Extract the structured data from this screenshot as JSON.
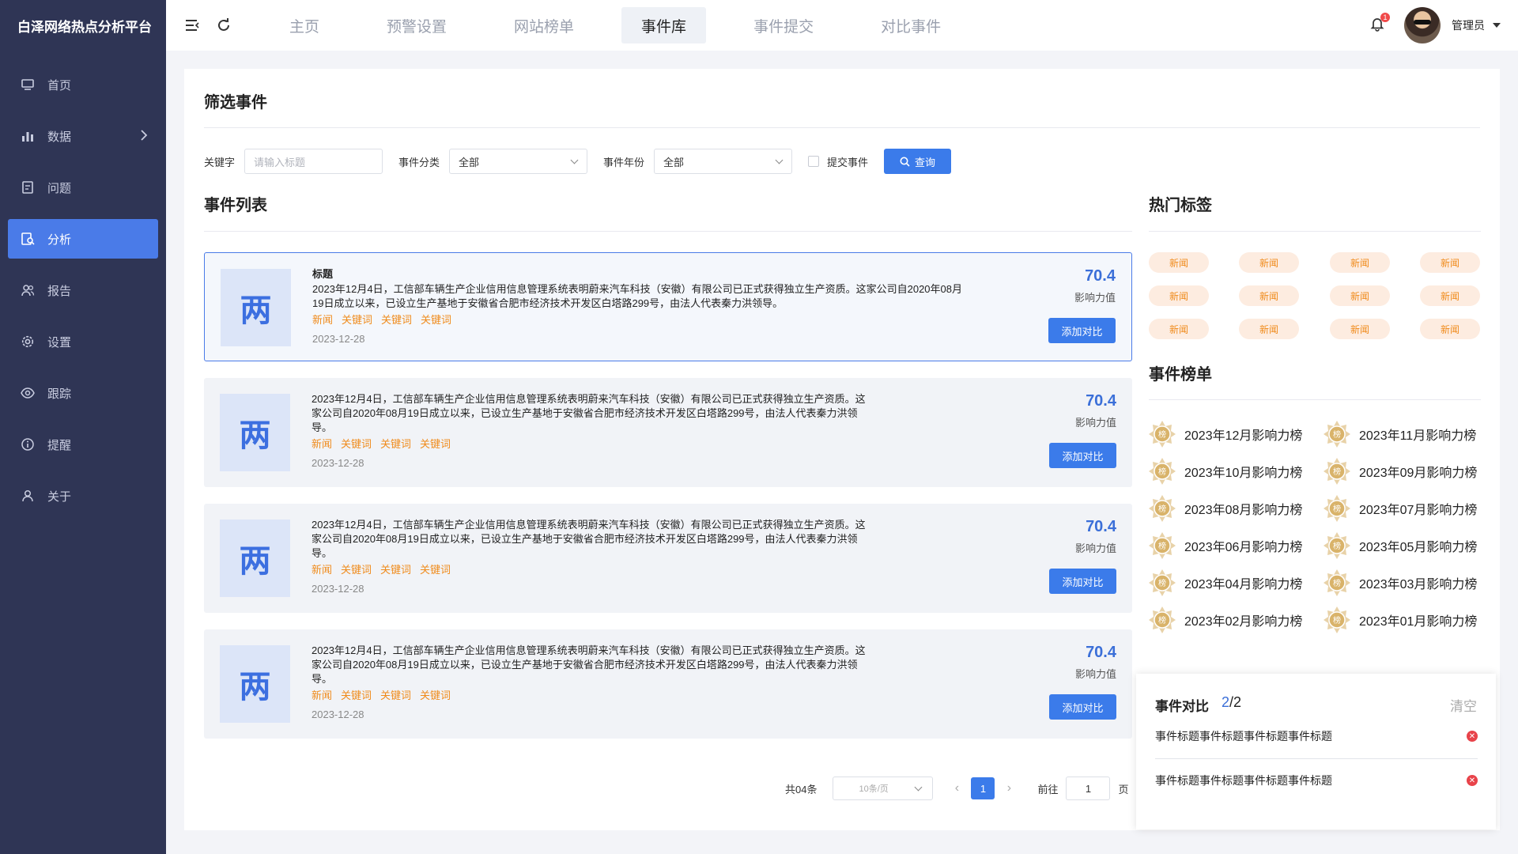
{
  "app": {
    "title": "白泽网络热点分析平台"
  },
  "sidebar": {
    "items": [
      {
        "label": "首页",
        "icon": "monitor-icon"
      },
      {
        "label": "数据",
        "icon": "bar-chart-icon"
      },
      {
        "label": "问题",
        "icon": "document-icon"
      },
      {
        "label": "分析",
        "icon": "analysis-icon",
        "active": true
      },
      {
        "label": "报告",
        "icon": "users-icon"
      },
      {
        "label": "设置",
        "icon": "gear-icon"
      },
      {
        "label": "跟踪",
        "icon": "eye-icon"
      },
      {
        "label": "提醒",
        "icon": "info-icon"
      },
      {
        "label": "关于",
        "icon": "user-icon"
      }
    ]
  },
  "header": {
    "tabs": [
      {
        "label": "主页"
      },
      {
        "label": "预警设置"
      },
      {
        "label": "网站榜单"
      },
      {
        "label": "事件库",
        "active": true
      },
      {
        "label": "事件提交"
      },
      {
        "label": "对比事件"
      }
    ],
    "notification_count": "1",
    "username": "管理员"
  },
  "filter": {
    "title": "筛选事件",
    "keyword_label": "关键字",
    "keyword_placeholder": "请输入标题",
    "category_label": "事件分类",
    "category_value": "全部",
    "year_label": "事件年份",
    "year_value": "全部",
    "submitted_label": "提交事件",
    "query_button": "查询"
  },
  "event_list": {
    "title": "事件列表",
    "items": [
      {
        "thumb": "两",
        "title": "标题",
        "lines": [
          "2023年12月4日，工信部车辆生产企业信用信息管理系统表明蔚来汽车科技（安徽）有限公司已正式获得独立生产资质。这家公司自2020年08月",
          "19日成立以来，已设立生产基地于安徽省合肥市经济技术开发区白塔路299号，由法人代表秦力洪领导。"
        ],
        "tags": [
          "新闻",
          "关键词",
          "关键词",
          "关键词"
        ],
        "date": "2023-12-28",
        "score": "70.4",
        "score_label": "影响力值",
        "button": "添加对比"
      },
      {
        "thumb": "两",
        "title": "",
        "lines": [
          "2023年12月4日，工信部车辆生产企业信用信息管理系统表明蔚来汽车科技（安徽）有限公司已正式获得独立生产资质。这",
          "家公司自2020年08月19日成立以来，已设立生产基地于安徽省合肥市经济技术开发区白塔路299号，由法人代表秦力洪领",
          "导。"
        ],
        "tags": [
          "新闻",
          "关键词",
          "关键词",
          "关键词"
        ],
        "date": "2023-12-28",
        "score": "70.4",
        "score_label": "影响力值",
        "button": "添加对比"
      },
      {
        "thumb": "两",
        "title": "",
        "lines": [
          "2023年12月4日，工信部车辆生产企业信用信息管理系统表明蔚来汽车科技（安徽）有限公司已正式获得独立生产资质。这",
          "家公司自2020年08月19日成立以来，已设立生产基地于安徽省合肥市经济技术开发区白塔路299号，由法人代表秦力洪领",
          "导。"
        ],
        "tags": [
          "新闻",
          "关键词",
          "关键词",
          "关键词"
        ],
        "date": "2023-12-28",
        "score": "70.4",
        "score_label": "影响力值",
        "button": "添加对比"
      },
      {
        "thumb": "两",
        "title": "",
        "lines": [
          "2023年12月4日，工信部车辆生产企业信用信息管理系统表明蔚来汽车科技（安徽）有限公司已正式获得独立生产资质。这",
          "家公司自2020年08月19日成立以来，已设立生产基地于安徽省合肥市经济技术开发区白塔路299号，由法人代表秦力洪领",
          "导。"
        ],
        "tags": [
          "新闻",
          "关键词",
          "关键词",
          "关键词"
        ],
        "date": "2023-12-28",
        "score": "70.4",
        "score_label": "影响力值",
        "button": "添加对比"
      }
    ]
  },
  "pagination": {
    "total": "共04条",
    "page_size": "10条/页",
    "current": "1",
    "goto_label": "前往",
    "goto_value": "1",
    "page_suffix": "页"
  },
  "hot_tags": {
    "title": "热门标签",
    "tags": [
      "新闻",
      "新闻",
      "新闻",
      "新闻",
      "新闻",
      "新闻",
      "新闻",
      "新闻",
      "新闻",
      "新闻",
      "新闻",
      "新闻"
    ]
  },
  "ranking": {
    "title": "事件榜单",
    "medal_text": "榜",
    "items": [
      "2023年12月影响力榜",
      "2023年11月影响力榜",
      "2023年10月影响力榜",
      "2023年09月影响力榜",
      "2023年08月影响力榜",
      "2023年07月影响力榜",
      "2023年06月影响力榜",
      "2023年05月影响力榜",
      "2023年04月影响力榜",
      "2023年03月影响力榜",
      "2023年02月影响力榜",
      "2023年01月影响力榜"
    ]
  },
  "compare": {
    "title": "事件对比",
    "count_current": "2",
    "count_total": "/2",
    "clear": "清空",
    "items": [
      "事件标题事件标题事件标题事件标题",
      "事件标题事件标题事件标题事件标题"
    ]
  },
  "colors": {
    "sidebar_bg": "#2f3555",
    "accent": "#3b7bea",
    "tag": "#f08b1c",
    "score": "#3b6fd8"
  }
}
